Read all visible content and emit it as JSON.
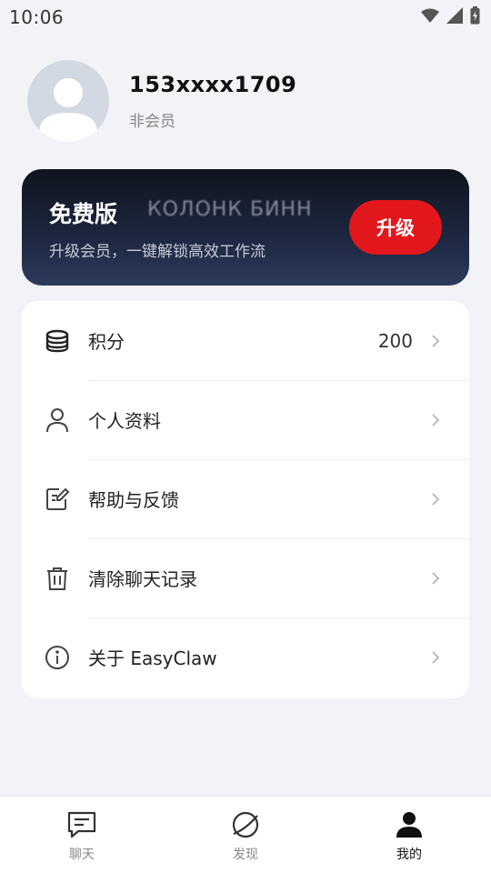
{
  "status_bar": {
    "time": "10:06",
    "icons": [
      "wifi-icon",
      "cellular-signal-icon",
      "battery-charging-icon"
    ]
  },
  "profile": {
    "username": "153xxxx1709",
    "membership_status": "非会员",
    "avatar_icon": "default-user-avatar"
  },
  "member_card": {
    "title": "免费版",
    "title_effect_text": "КОЛОНК БИНН",
    "subtitle": "升级会员，一键解锁高效工作流",
    "upgrade_label": "升级",
    "upgrade_color": "#e2171c"
  },
  "menu": {
    "items": [
      {
        "label": "积分",
        "value": "200",
        "icon": "coins-stack-icon"
      },
      {
        "label": "个人资料",
        "value": "",
        "icon": "user-icon"
      },
      {
        "label": "帮助与反馈",
        "value": "",
        "icon": "feedback-edit-icon"
      },
      {
        "label": "清除聊天记录",
        "value": "",
        "icon": "trash-icon"
      },
      {
        "label": "关于 EasyClaw",
        "value": "",
        "icon": "info-icon"
      }
    ]
  },
  "bottom_nav": {
    "items": [
      {
        "label": "聊天",
        "icon": "chat-icon",
        "active": false
      },
      {
        "label": "发现",
        "icon": "planet-icon",
        "active": false
      },
      {
        "label": "我的",
        "icon": "person-icon",
        "active": true
      }
    ]
  },
  "colors": {
    "background": "#f2f3f7",
    "card_dark": "#1d2740",
    "accent_red": "#e2171c"
  }
}
